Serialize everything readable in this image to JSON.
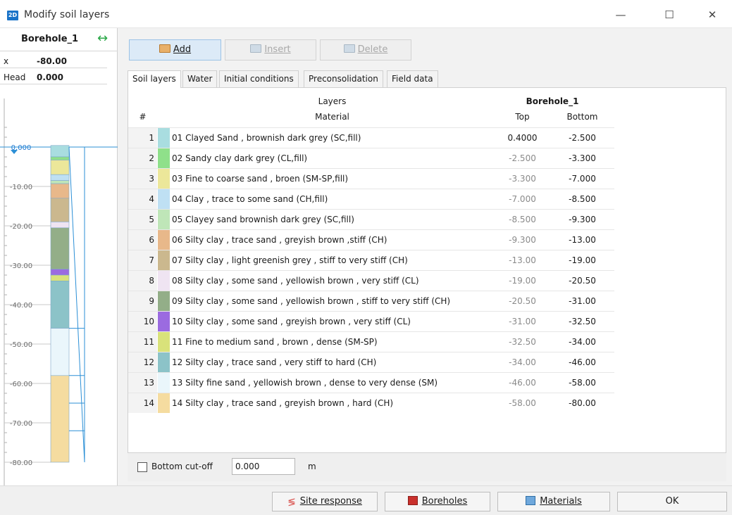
{
  "window": {
    "app_icon_text": "2D",
    "title": "Modify soil layers",
    "controls": {
      "minimize": "—",
      "maximize": "☐",
      "close": "✕"
    }
  },
  "left_panel": {
    "borehole_name": "Borehole_1",
    "swap_icon": "↔",
    "props": [
      {
        "key": "x",
        "value": "-80.00"
      },
      {
        "key": "Head",
        "value": "0.000"
      }
    ],
    "depth_axis": {
      "ticks": [
        "0.000",
        "-10.00",
        "-20.00",
        "-30.00",
        "-40.00",
        "-50.00",
        "-60.00",
        "-70.00",
        "-80.00"
      ]
    }
  },
  "toolbar": {
    "add_label": "Add",
    "insert_label": "Insert",
    "delete_label": "Delete"
  },
  "tabs": [
    "Soil layers",
    "Water",
    "Initial conditions",
    "Preconsolidation",
    "Field data"
  ],
  "grid": {
    "header_layers": "Layers",
    "header_borehole": "Borehole_1",
    "col_num": "#",
    "col_material": "Material",
    "col_top": "Top",
    "col_bottom": "Bottom"
  },
  "layers": [
    {
      "num": "1",
      "material": "01 Clayed Sand , brownish dark grey (SC,fill)",
      "top": "0.4000",
      "bottom": "-2.500",
      "color": "#a9dde0"
    },
    {
      "num": "2",
      "material": "02 Sandy clay dark grey (CL,fill)",
      "top": "-2.500",
      "bottom": "-3.300",
      "color": "#8fe08a"
    },
    {
      "num": "3",
      "material": "03 Fine to coarse sand , broen (SM-SP,fill)",
      "top": "-3.300",
      "bottom": "-7.000",
      "color": "#ece79a"
    },
    {
      "num": "4",
      "material": "04 Clay , trace to some sand (CH,fill)",
      "top": "-7.000",
      "bottom": "-8.500",
      "color": "#bfe0f3"
    },
    {
      "num": "5",
      "material": "05 Clayey sand brownish dark grey (SC,fill)",
      "top": "-8.500",
      "bottom": "-9.300",
      "color": "#bfe6b8"
    },
    {
      "num": "6",
      "material": "06 Silty clay , trace sand , greyish brown ,stiff (CH)",
      "top": "-9.300",
      "bottom": "-13.00",
      "color": "#e8b88a"
    },
    {
      "num": "7",
      "material": "07 Silty clay , light greenish grey , stiff to very stiff (CH)",
      "top": "-13.00",
      "bottom": "-19.00",
      "color": "#cbb88e"
    },
    {
      "num": "8",
      "material": "08 Silty clay , some sand , yellowish brown , very stiff (CL)",
      "top": "-19.00",
      "bottom": "-20.50",
      "color": "#efe4f2"
    },
    {
      "num": "9",
      "material": "09 Silty clay , some sand , yellowish brown , stiff to very stiff (CH)",
      "top": "-20.50",
      "bottom": "-31.00",
      "color": "#93ae88"
    },
    {
      "num": "10",
      "material": "10 Silty clay , some sand , greyish brown , very stiff (CL)",
      "top": "-31.00",
      "bottom": "-32.50",
      "color": "#9b6be0"
    },
    {
      "num": "11",
      "material": "11 Fine to medium sand , brown , dense (SM-SP)",
      "top": "-32.50",
      "bottom": "-34.00",
      "color": "#d9e27a"
    },
    {
      "num": "12",
      "material": "12 Silty clay , trace sand , very stiff to hard (CH)",
      "top": "-34.00",
      "bottom": "-46.00",
      "color": "#8cc3c8"
    },
    {
      "num": "13",
      "material": "13 Silty fine sand , yellowish brown , dense to very dense (SM)",
      "top": "-46.00",
      "bottom": "-58.00",
      "color": "#eaf6fb"
    },
    {
      "num": "14",
      "material": "14 Silty clay , trace sand , greyish brown , hard (CH)",
      "top": "-58.00",
      "bottom": "-80.00",
      "color": "#f5dca0"
    }
  ],
  "cutoff": {
    "label": "Bottom cut-off",
    "value": "0.000",
    "unit": "m",
    "checked": false
  },
  "footer": {
    "site_response_label": "Site response",
    "boreholes_label": "Boreholes",
    "materials_label": "Materials",
    "ok_label": "OK"
  }
}
